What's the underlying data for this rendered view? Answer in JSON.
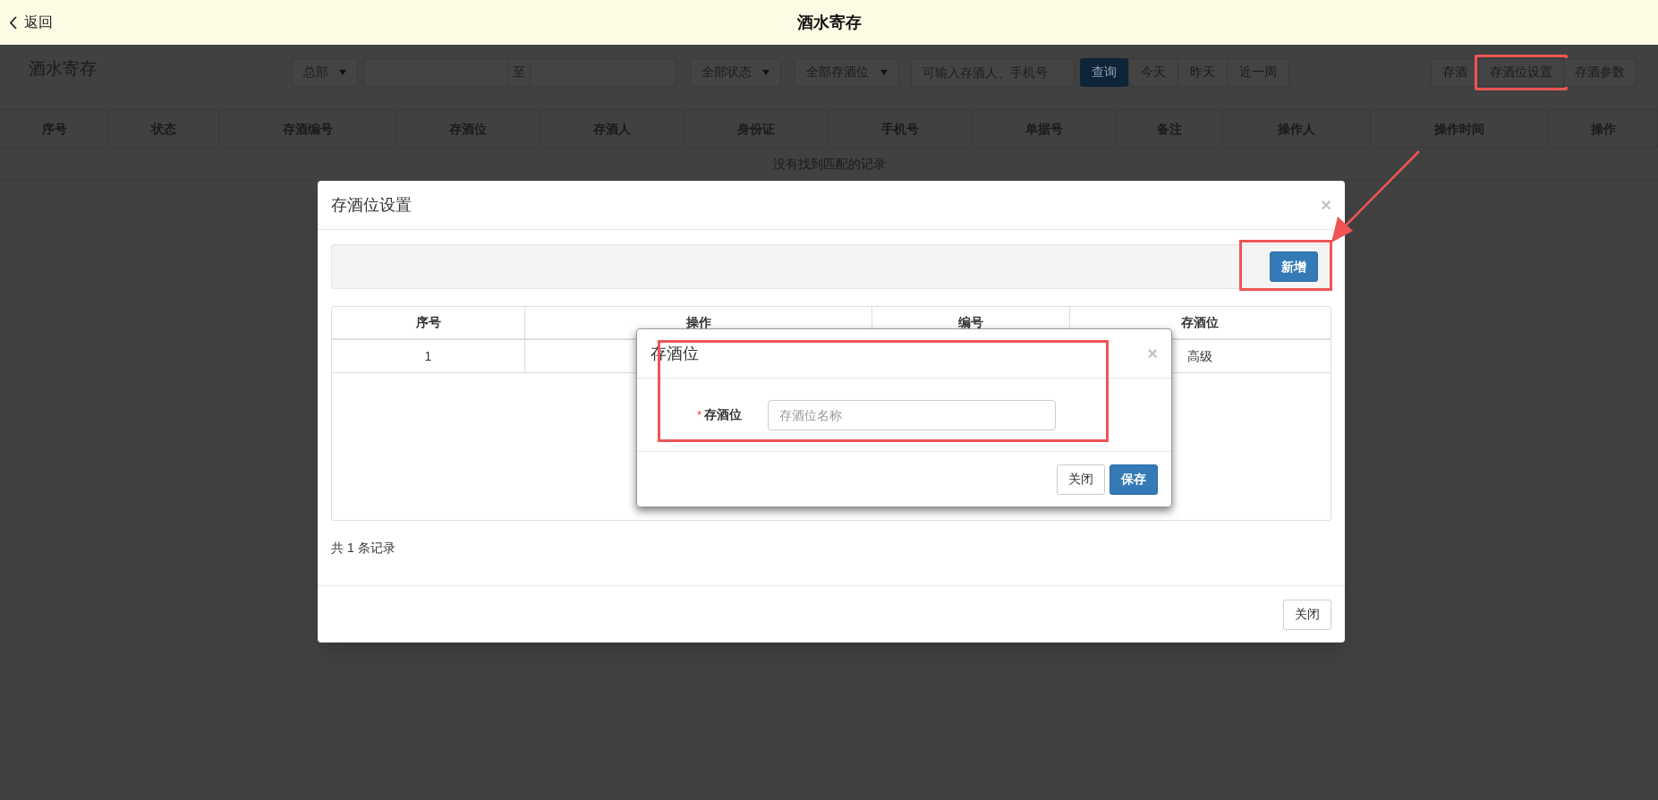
{
  "header": {
    "back_label": "返回",
    "title": "酒水寄存"
  },
  "toolbar": {
    "title": "酒水寄存",
    "branch_select": "总部",
    "date_separator": "至",
    "status_select": "全部状态",
    "location_select": "全部存酒位",
    "search_placeholder": "可输入存酒人、手机号",
    "query_button": "查询",
    "quick_ranges": [
      "今天",
      "昨天",
      "近一周"
    ],
    "actions": [
      {
        "label": "存酒",
        "highlighted": false
      },
      {
        "label": "存酒位设置",
        "highlighted": true
      },
      {
        "label": "存酒参数",
        "highlighted": false
      }
    ]
  },
  "table": {
    "columns": [
      "序号",
      "状态",
      "存酒编号",
      "存酒位",
      "存酒人",
      "身份证",
      "手机号",
      "单据号",
      "备注",
      "操作人",
      "操作时间",
      "操作"
    ],
    "empty_message": "没有找到匹配的记录"
  },
  "location_settings_dialog": {
    "title": "存酒位设置",
    "close_icon": "×",
    "add_button": {
      "label": "新增",
      "highlighted": true
    },
    "table": {
      "columns": [
        "序号",
        "操作",
        "编号",
        "存酒位"
      ],
      "rows": [
        {
          "number": "1",
          "location": "高级"
        }
      ]
    },
    "record_count": "共 1 条记录",
    "close_button": "关闭"
  },
  "location_dialog": {
    "title": "存酒位",
    "close_icon": "×",
    "highlighted": true,
    "field": {
      "required_marker": "*",
      "label": "存酒位",
      "placeholder": "存酒位名称"
    },
    "close_button": "关闭",
    "save_button": "保存"
  }
}
